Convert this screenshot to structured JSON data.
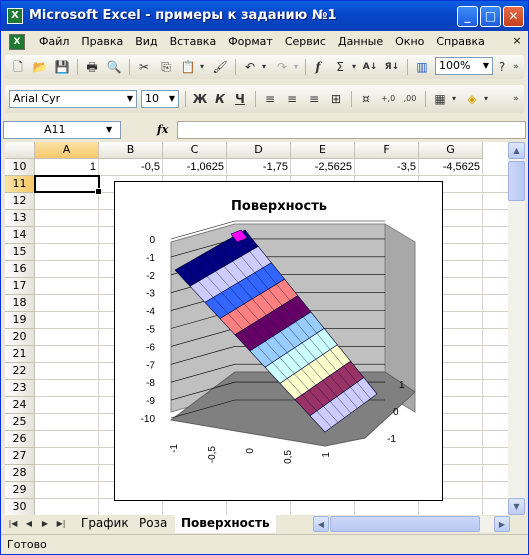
{
  "window": {
    "title": "Microsoft Excel - примеры к заданию  №1",
    "buttons": {
      "minimize": "_",
      "maximize": "□",
      "close": "✕"
    }
  },
  "menu": {
    "items": [
      "Файл",
      "Правка",
      "Вид",
      "Вставка",
      "Формат",
      "Сервис",
      "Данные",
      "Окно",
      "Справка"
    ],
    "close_doc": "×"
  },
  "toolbar_std": {
    "zoom": "100%"
  },
  "toolbar_fmt": {
    "font": "Arial Cyr",
    "size": "10",
    "bold": "Ж",
    "italic": "К",
    "underline": "Ч"
  },
  "formula_bar": {
    "name_box": "A11",
    "fx": "fx",
    "value": ""
  },
  "sheet": {
    "columns": [
      "A",
      "B",
      "C",
      "D",
      "E",
      "F",
      "G"
    ],
    "rows": [
      "10",
      "11",
      "12",
      "13",
      "14",
      "15",
      "16",
      "17",
      "18",
      "19",
      "20",
      "21",
      "22",
      "23",
      "24",
      "25",
      "26",
      "27",
      "28",
      "29",
      "30"
    ],
    "row10_values": [
      "1",
      "-0,5",
      "-1,0625",
      "-1,75",
      "-2,5625",
      "-3,5",
      "-4,5625"
    ],
    "selected_cell": "A11"
  },
  "tabs": {
    "items": [
      "График",
      "Роза",
      "Поверхность"
    ],
    "active": "Поверхность"
  },
  "status": {
    "text": "Готово"
  },
  "chart_data": {
    "type": "surface",
    "title": "Поверхность",
    "z_ticks": [
      "0",
      "-1",
      "-2",
      "-3",
      "-4",
      "-5",
      "-6",
      "-7",
      "-8",
      "-9",
      "-10"
    ],
    "x_ticks": [
      "-1",
      "-0,5",
      "0",
      "0,5",
      "1"
    ],
    "y_ticks": [
      "-1",
      "0",
      "1"
    ],
    "zlim": [
      -10,
      0
    ],
    "band_colors": [
      "#000080",
      "#ccccff",
      "#3366ff",
      "#ff8080",
      "#660066",
      "#99ccff",
      "#ccffff",
      "#ffffcc",
      "#993366",
      "#ccccff",
      "#ff00ff"
    ]
  }
}
